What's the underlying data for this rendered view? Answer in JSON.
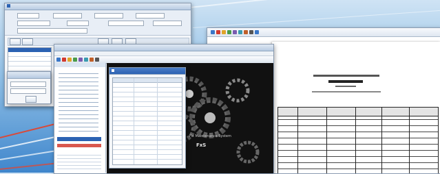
{
  "background": {
    "colors": {
      "sky": "#cfe3f4",
      "blue": "#3f86cc",
      "streak_red": "#d94a3a",
      "streak_white": "#ffffff"
    }
  },
  "entry_window": {
    "icon": "form-window-icon"
  },
  "report_window": {
    "toolbar_icons": [
      "print-icon",
      "save-icon",
      "search-icon",
      "zoom-icon",
      "page-setup-icon",
      "first-page-icon",
      "prev-page-icon",
      "next-page-icon",
      "last-page-icon"
    ]
  },
  "main_window": {
    "menu": [],
    "toolbar_icons": [
      "home-icon",
      "document-icon",
      "folder-icon",
      "chart-icon",
      "settings-icon",
      "user-icon",
      "report-icon",
      "exit-icon"
    ],
    "splash": {
      "text": "Fix Maintenance System",
      "short": "FxS"
    }
  },
  "dialog": {
    "title_icon": "list-icon"
  },
  "colors": {
    "accent": "#2b62b3",
    "highlight": "#d23a2f",
    "splash_bg": "#111111"
  }
}
